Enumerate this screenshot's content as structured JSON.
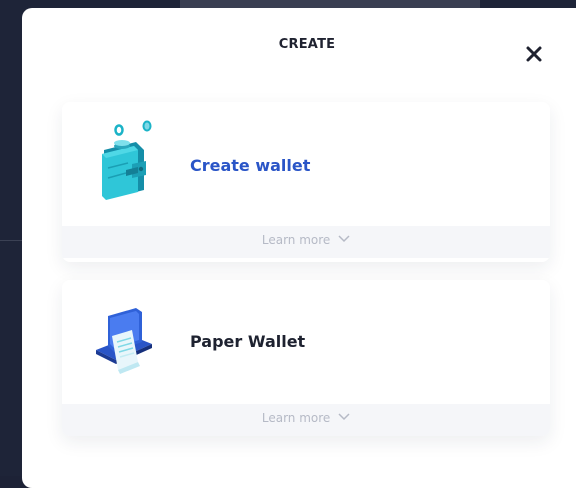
{
  "modal": {
    "title": "CREATE",
    "close_icon": "close-icon"
  },
  "options": [
    {
      "label": "Create wallet",
      "icon": "wallet-icon",
      "learn_more": "Learn more",
      "label_color": "#2a55c7"
    },
    {
      "label": "Paper Wallet",
      "icon": "paper-wallet-icon",
      "learn_more": "Learn more",
      "label_color": "#1e2230"
    }
  ],
  "colors": {
    "accent": "#2a55c7",
    "teal": "#1bb3c7",
    "muted_text": "#b6bac6"
  }
}
